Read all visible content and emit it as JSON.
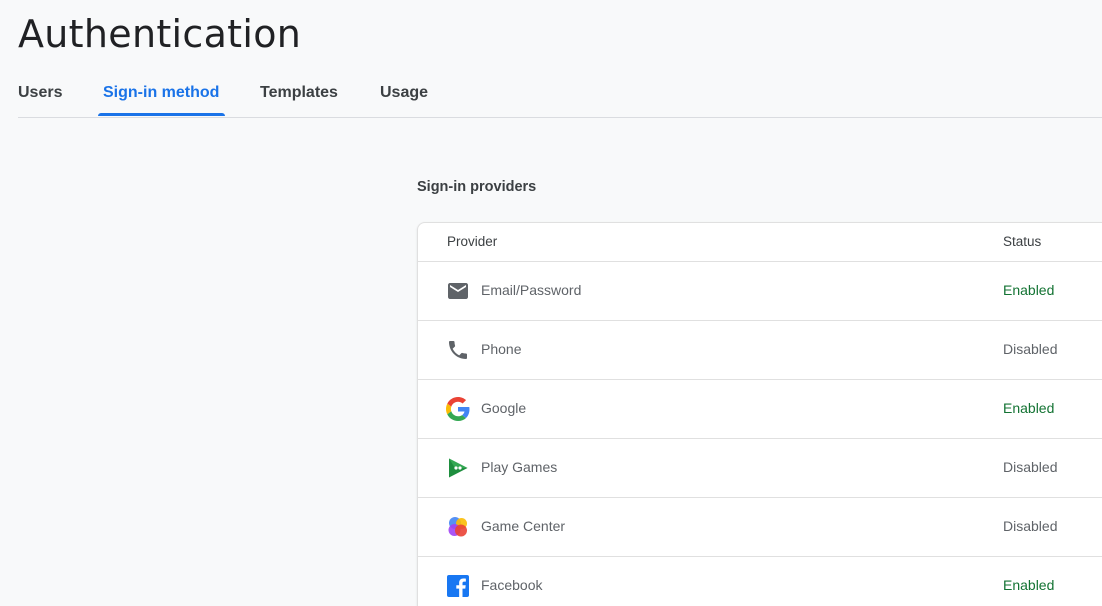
{
  "page": {
    "title": "Authentication"
  },
  "tabs": [
    {
      "label": "Users"
    },
    {
      "label": "Sign-in method",
      "active": true
    },
    {
      "label": "Templates"
    },
    {
      "label": "Usage"
    }
  ],
  "providers_section": {
    "title": "Sign-in providers",
    "columns": {
      "provider": "Provider",
      "status": "Status"
    },
    "rows": [
      {
        "name": "Email/Password",
        "status": "Enabled",
        "icon": "mail-icon"
      },
      {
        "name": "Phone",
        "status": "Disabled",
        "icon": "phone-icon"
      },
      {
        "name": "Google",
        "status": "Enabled",
        "icon": "google-icon"
      },
      {
        "name": "Play Games",
        "status": "Disabled",
        "icon": "play-games-icon"
      },
      {
        "name": "Game Center",
        "status": "Disabled",
        "icon": "game-center-icon"
      },
      {
        "name": "Facebook",
        "status": "Enabled",
        "icon": "facebook-icon"
      }
    ]
  },
  "colors": {
    "accent": "#1a73e8",
    "enabled": "#137333",
    "disabled": "#5f6368"
  }
}
